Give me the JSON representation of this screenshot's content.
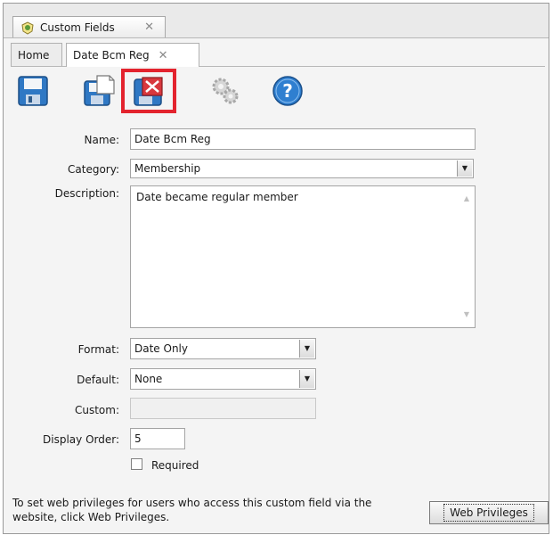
{
  "window": {
    "tab_label": "Custom Fields",
    "tab_close": "✕"
  },
  "tabs": [
    {
      "label": "Home"
    },
    {
      "label": "Date Bcm Reg",
      "close": "✕"
    }
  ],
  "toolbar": {
    "buttons": [
      "save-icon",
      "save-new-icon",
      "delete-icon",
      "settings-icon",
      "help-icon"
    ],
    "highlighted": "delete-icon",
    "highlight_color": "#e3232e"
  },
  "form": {
    "name_label": "Name:",
    "name_value": "Date Bcm Reg",
    "category_label": "Category:",
    "category_value": "Membership",
    "description_label": "Description:",
    "description_value": "Date became regular member",
    "format_label": "Format:",
    "format_value": "Date Only",
    "default_label": "Default:",
    "default_value": "None",
    "custom_label": "Custom:",
    "custom_value": "",
    "display_order_label": "Display Order:",
    "display_order_value": "5",
    "required_label": "Required",
    "required_checked": false
  },
  "footer": {
    "info_text": "To set web privileges for users who access this custom field via the website, click Web Privileges.",
    "web_privileges_label": "Web Privileges"
  }
}
